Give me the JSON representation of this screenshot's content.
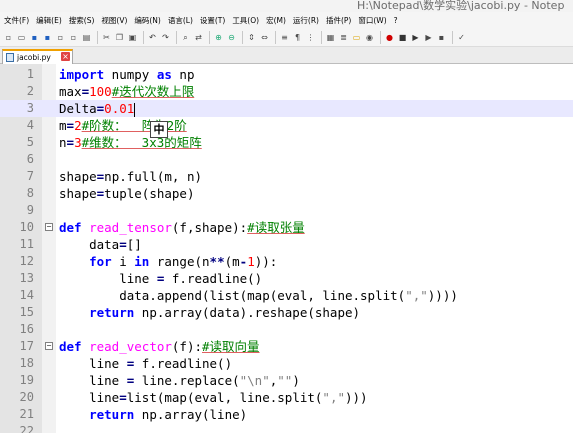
{
  "window": {
    "title": "H:\\Notepad\\数学实验\\jacobi.py - Notep"
  },
  "menu": [
    "文件(F)",
    "编辑(E)",
    "搜索(S)",
    "视图(V)",
    "编码(N)",
    "语言(L)",
    "设置(T)",
    "工具(O)",
    "宏(M)",
    "运行(R)",
    "插件(P)",
    "窗口(W)",
    "?"
  ],
  "toolbar_icons": [
    "new-file-icon",
    "open-file-icon",
    "save-icon",
    "save-all-icon",
    "close-icon",
    "close-all-icon",
    "print-icon",
    "sep",
    "cut-icon",
    "copy-icon",
    "paste-icon",
    "sep",
    "undo-icon",
    "redo-icon",
    "sep",
    "find-icon",
    "replace-icon",
    "sep",
    "zoom-in-icon",
    "zoom-out-icon",
    "sep",
    "sync-v-icon",
    "sync-h-icon",
    "sep",
    "word-wrap-icon",
    "show-all-chars-icon",
    "indent-guide-icon",
    "sep",
    "doc-map-icon",
    "function-list-icon",
    "folder-icon",
    "monitor-icon",
    "sep",
    "record-macro-icon",
    "stop-macro-icon",
    "play-macro-icon",
    "play-multi-icon",
    "save-macro-icon",
    "sep",
    "spellcheck-icon"
  ],
  "tab": {
    "filename": "jacobi.py",
    "close_label": "×"
  },
  "ime": {
    "label": "中"
  },
  "lines": [
    {
      "n": "1",
      "tokens": [
        {
          "t": "import",
          "c": "kw"
        },
        {
          "t": " numpy "
        },
        {
          "t": "as",
          "c": "kw"
        },
        {
          "t": " np"
        }
      ]
    },
    {
      "n": "2",
      "tokens": [
        {
          "t": "max"
        },
        {
          "t": "=",
          "c": "op"
        },
        {
          "t": "100",
          "c": "num"
        },
        {
          "t": "#迭代次数上限",
          "c": "cmu"
        }
      ]
    },
    {
      "n": "3",
      "current": true,
      "tokens": [
        {
          "t": "Delta"
        },
        {
          "t": "=",
          "c": "op"
        },
        {
          "t": "0.01",
          "c": "num"
        },
        {
          "t": "caret",
          "c": "caret"
        }
      ]
    },
    {
      "n": "4",
      "tokens": [
        {
          "t": "m"
        },
        {
          "t": "=",
          "c": "op"
        },
        {
          "t": "2",
          "c": "num"
        },
        {
          "t": "#阶数：  阵为2阶",
          "c": "cmu"
        }
      ]
    },
    {
      "n": "5",
      "tokens": [
        {
          "t": "n"
        },
        {
          "t": "=",
          "c": "op"
        },
        {
          "t": "3",
          "c": "num"
        },
        {
          "t": "#维数：  3x3的矩阵",
          "c": "cmu"
        }
      ]
    },
    {
      "n": "6",
      "tokens": []
    },
    {
      "n": "7",
      "tokens": [
        {
          "t": "shape"
        },
        {
          "t": "=",
          "c": "op"
        },
        {
          "t": "np.full(m, n)"
        }
      ]
    },
    {
      "n": "8",
      "tokens": [
        {
          "t": "shape"
        },
        {
          "t": "=",
          "c": "op"
        },
        {
          "t": "tuple(shape)"
        }
      ]
    },
    {
      "n": "9",
      "tokens": []
    },
    {
      "n": "10",
      "fold": "−",
      "tokens": [
        {
          "t": "def",
          "c": "kw"
        },
        {
          "t": " "
        },
        {
          "t": "read_tensor",
          "c": "fn"
        },
        {
          "t": "(f,shape):"
        },
        {
          "t": "#读取张量",
          "c": "cmu"
        }
      ]
    },
    {
      "n": "11",
      "tokens": [
        {
          "t": "    data"
        },
        {
          "t": "=",
          "c": "op"
        },
        {
          "t": "[]"
        }
      ]
    },
    {
      "n": "12",
      "tokens": [
        {
          "t": "    "
        },
        {
          "t": "for",
          "c": "kw"
        },
        {
          "t": " i "
        },
        {
          "t": "in",
          "c": "kw"
        },
        {
          "t": " range(n"
        },
        {
          "t": "**",
          "c": "op"
        },
        {
          "t": "(m"
        },
        {
          "t": "-",
          "c": "op"
        },
        {
          "t": "1",
          "c": "num"
        },
        {
          "t": ")):"
        }
      ]
    },
    {
      "n": "13",
      "tokens": [
        {
          "t": "        line "
        },
        {
          "t": "=",
          "c": "op"
        },
        {
          "t": " f.readline()"
        }
      ]
    },
    {
      "n": "14",
      "tokens": [
        {
          "t": "        data.append(list(map(eval, line.split("
        },
        {
          "t": "\",\"",
          "c": "str"
        },
        {
          "t": "))))"
        }
      ]
    },
    {
      "n": "15",
      "tokens": [
        {
          "t": "    "
        },
        {
          "t": "return",
          "c": "kw"
        },
        {
          "t": " np.array(data).reshape(shape)"
        }
      ]
    },
    {
      "n": "16",
      "tokens": []
    },
    {
      "n": "17",
      "fold": "−",
      "tokens": [
        {
          "t": "def",
          "c": "kw"
        },
        {
          "t": " "
        },
        {
          "t": "read_vector",
          "c": "fn"
        },
        {
          "t": "(f):"
        },
        {
          "t": "#读取向量",
          "c": "cmu"
        }
      ]
    },
    {
      "n": "18",
      "tokens": [
        {
          "t": "    line "
        },
        {
          "t": "=",
          "c": "op"
        },
        {
          "t": " f.readline()"
        }
      ]
    },
    {
      "n": "19",
      "tokens": [
        {
          "t": "    line "
        },
        {
          "t": "=",
          "c": "op"
        },
        {
          "t": " line.replace("
        },
        {
          "t": "\"\\n\"",
          "c": "str"
        },
        {
          "t": ","
        },
        {
          "t": "\"\"",
          "c": "str"
        },
        {
          "t": ")"
        }
      ]
    },
    {
      "n": "20",
      "tokens": [
        {
          "t": "    line"
        },
        {
          "t": "=",
          "c": "op"
        },
        {
          "t": "list(map(eval, line.split("
        },
        {
          "t": "\",\"",
          "c": "str"
        },
        {
          "t": ")))"
        }
      ]
    },
    {
      "n": "21",
      "tokens": [
        {
          "t": "    "
        },
        {
          "t": "return",
          "c": "kw"
        },
        {
          "t": " np.array(line)"
        }
      ]
    },
    {
      "n": "22",
      "tokens": []
    }
  ]
}
